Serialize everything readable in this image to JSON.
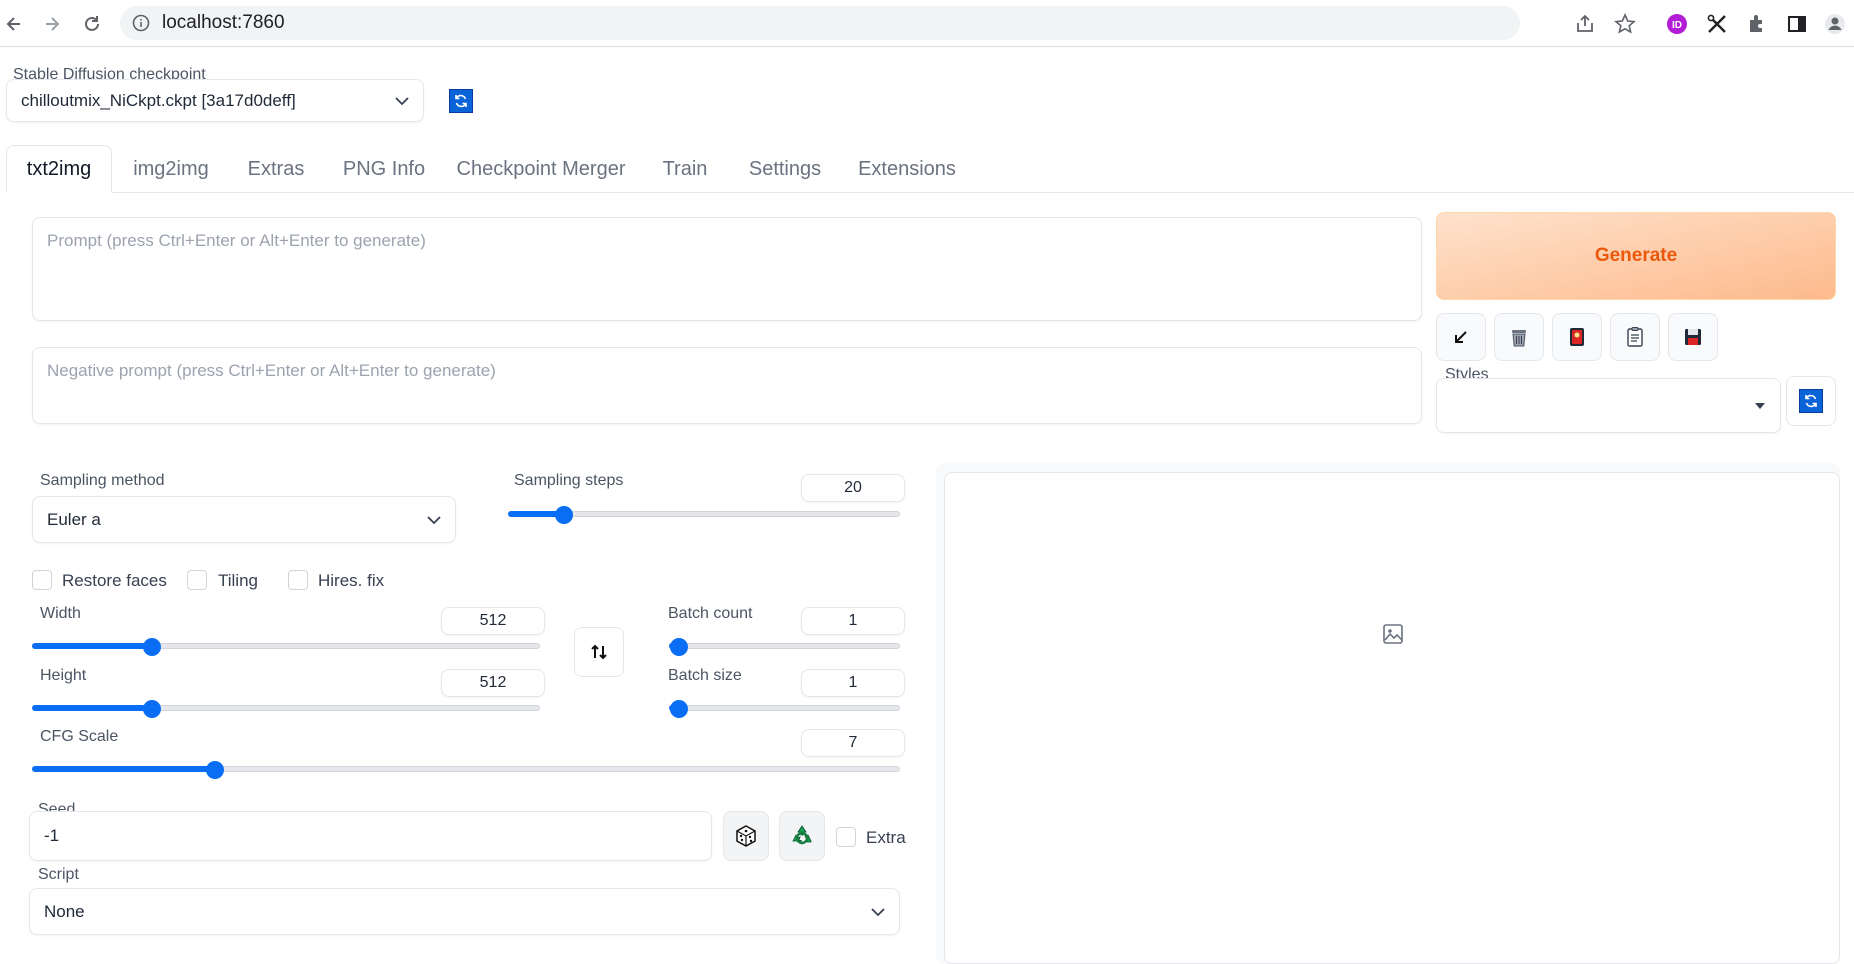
{
  "browser": {
    "url": "localhost:7860"
  },
  "checkpoint": {
    "label": "Stable Diffusion checkpoint",
    "value": "chilloutmix_NiCkpt.ckpt [3a17d0deff]"
  },
  "tabs": [
    {
      "label": "txt2img",
      "active": true
    },
    {
      "label": "img2img"
    },
    {
      "label": "Extras"
    },
    {
      "label": "PNG Info"
    },
    {
      "label": "Checkpoint Merger"
    },
    {
      "label": "Train"
    },
    {
      "label": "Settings"
    },
    {
      "label": "Extensions"
    }
  ],
  "prompt": {
    "placeholder": "Prompt (press Ctrl+Enter or Alt+Enter to generate)",
    "value": ""
  },
  "negative_prompt": {
    "placeholder": "Negative prompt (press Ctrl+Enter or Alt+Enter to generate)",
    "value": ""
  },
  "generate": {
    "label": "Generate"
  },
  "tool_buttons": [
    {
      "icon": "arrow-down-left-icon"
    },
    {
      "icon": "trash-icon"
    },
    {
      "icon": "red-card-icon"
    },
    {
      "icon": "clipboard-icon"
    },
    {
      "icon": "floppy-disk-icon"
    }
  ],
  "styles": {
    "label": "Styles",
    "value": ""
  },
  "sampling_method": {
    "label": "Sampling method",
    "value": "Euler a"
  },
  "sampling_steps": {
    "label": "Sampling steps",
    "value": "20",
    "fraction": 0.14
  },
  "checkboxes": {
    "restore_faces": "Restore faces",
    "tiling": "Tiling",
    "hires_fix": "Hires. fix"
  },
  "width": {
    "label": "Width",
    "value": "512",
    "fraction": 0.235
  },
  "height": {
    "label": "Height",
    "value": "512",
    "fraction": 0.235
  },
  "batch_count": {
    "label": "Batch count",
    "value": "1",
    "fraction": 0.0
  },
  "batch_size": {
    "label": "Batch size",
    "value": "1",
    "fraction": 0.0
  },
  "cfg_scale": {
    "label": "CFG Scale",
    "value": "7",
    "fraction": 0.21
  },
  "seed": {
    "label": "Seed",
    "value": "-1",
    "extra_label": "Extra"
  },
  "script": {
    "label": "Script",
    "value": "None"
  },
  "colors": {
    "accent": "#0a6ef5",
    "generate_text": "#ea580c"
  }
}
